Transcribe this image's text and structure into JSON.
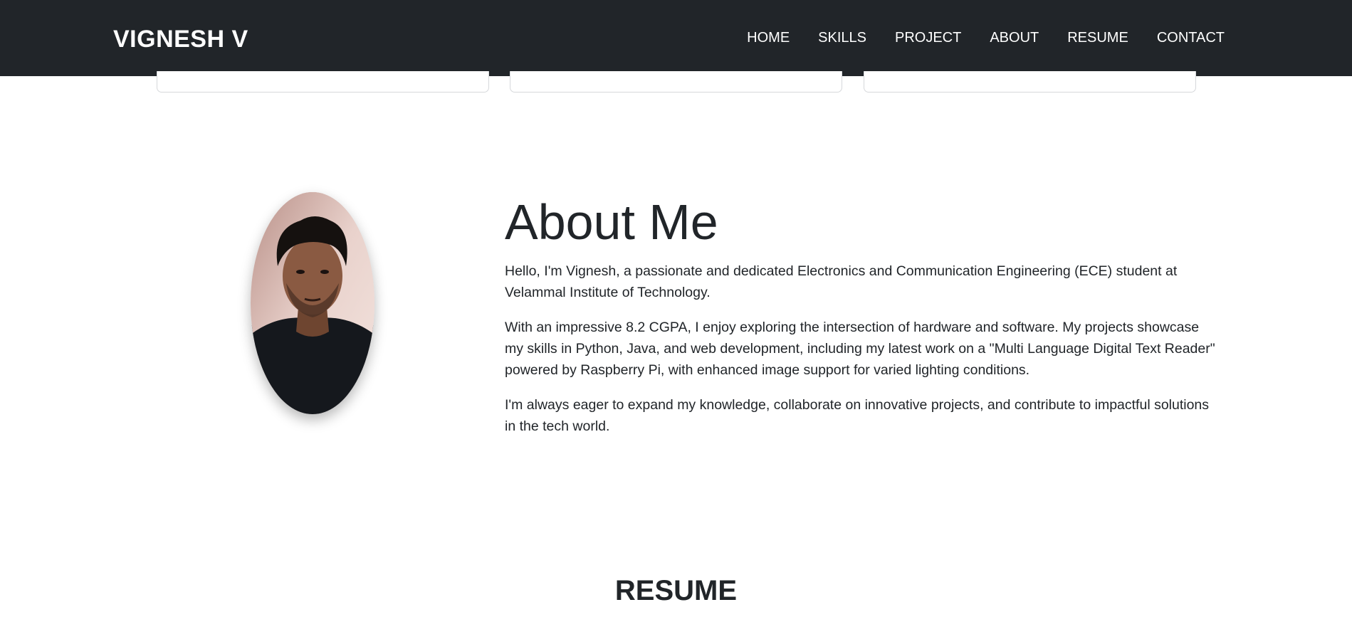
{
  "navbar": {
    "brand": "VIGNESH V",
    "links": [
      "HOME",
      "SKILLS",
      "PROJECT",
      "ABOUT",
      "RESUME",
      "CONTACT"
    ]
  },
  "about": {
    "title": "About Me",
    "paragraphs": [
      "Hello, I'm Vignesh, a passionate and dedicated Electronics and Communication Engineering (ECE) student at Velammal Institute of Technology.",
      "With an impressive 8.2 CGPA, I enjoy exploring the intersection of hardware and software. My projects showcase my skills in Python, Java, and web development, including my latest work on a \"Multi Language Digital Text Reader\" powered by Raspberry Pi, with enhanced image support for varied lighting conditions.",
      "I'm always eager to expand my knowledge, collaborate on innovative projects, and contribute to impactful solutions in the tech world."
    ]
  },
  "resume": {
    "title": "RESUME"
  },
  "colors": {
    "navbar_bg": "#212529",
    "text": "#212529",
    "nav_text": "#ffffff"
  }
}
